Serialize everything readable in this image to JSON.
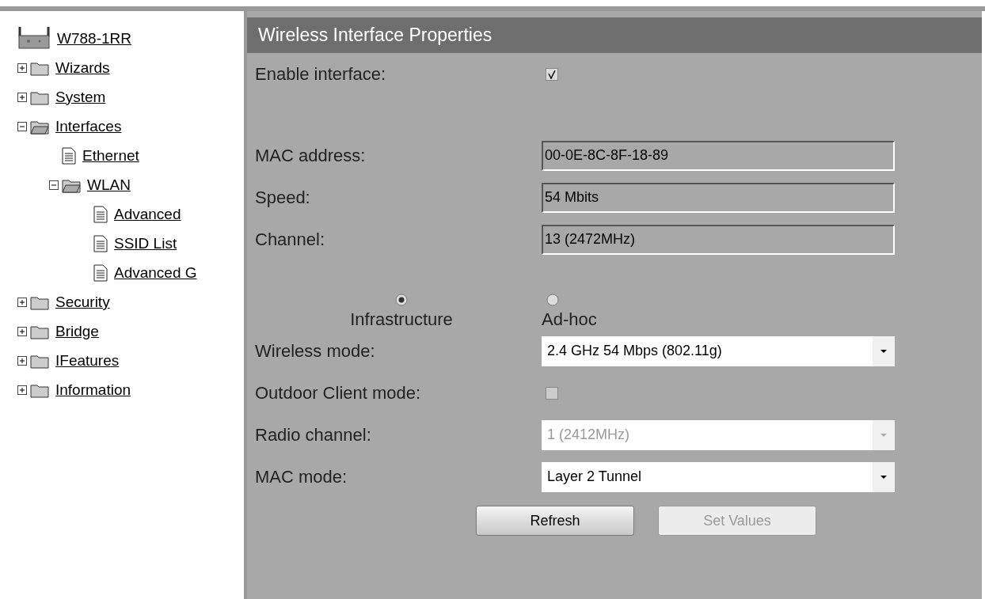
{
  "tree": {
    "label": "W788-1RR",
    "kind": "device",
    "children": [
      {
        "label": "Wizards",
        "kind": "folder",
        "expanded": false
      },
      {
        "label": "System",
        "kind": "folder",
        "expanded": false
      },
      {
        "label": "Interfaces",
        "kind": "folder",
        "expanded": true,
        "children": [
          {
            "label": "Ethernet",
            "kind": "page"
          },
          {
            "label": "WLAN",
            "kind": "folder",
            "expanded": true,
            "children": [
              {
                "label": "Advanced",
                "kind": "page"
              },
              {
                "label": "SSID List",
                "kind": "page"
              },
              {
                "label": "Advanced G",
                "kind": "page"
              }
            ]
          }
        ]
      },
      {
        "label": "Security",
        "kind": "folder",
        "expanded": false
      },
      {
        "label": "Bridge",
        "kind": "folder",
        "expanded": false
      },
      {
        "label": "IFeatures",
        "kind": "folder",
        "expanded": false
      },
      {
        "label": "Information",
        "kind": "folder",
        "expanded": false
      }
    ]
  },
  "panel": {
    "title": "Wireless Interface Properties",
    "enable": [
      {
        "label": "Enable interface:",
        "kind": "checkbox",
        "checked": true,
        "disabled": false
      }
    ],
    "status": [
      {
        "label": "MAC address:",
        "kind": "readonly",
        "value": "00-0E-8C-8F-18-89"
      },
      {
        "label": "Speed:",
        "kind": "readonly",
        "value": "54 Mbits"
      },
      {
        "label": "Channel:",
        "kind": "readonly",
        "value": "13 (2472MHz)"
      }
    ],
    "mode_options": [
      {
        "label": "Infrastructure",
        "selected": true
      },
      {
        "label": "Ad-hoc",
        "selected": false
      }
    ],
    "settings": [
      {
        "label": "Wireless mode:",
        "kind": "select",
        "value": "2.4 GHz 54 Mbps (802.11g)",
        "disabled": false
      },
      {
        "label": "Outdoor Client mode:",
        "kind": "checkbox",
        "checked": false,
        "disabled": true
      },
      {
        "label": "Radio channel:",
        "kind": "select",
        "value": "1 (2412MHz)",
        "disabled": true
      },
      {
        "label": "MAC mode:",
        "kind": "select",
        "value": "Layer 2 Tunnel",
        "disabled": false
      }
    ],
    "buttons": [
      {
        "label": "Refresh",
        "disabled": false
      },
      {
        "label": "Set Values",
        "disabled": true
      }
    ]
  }
}
